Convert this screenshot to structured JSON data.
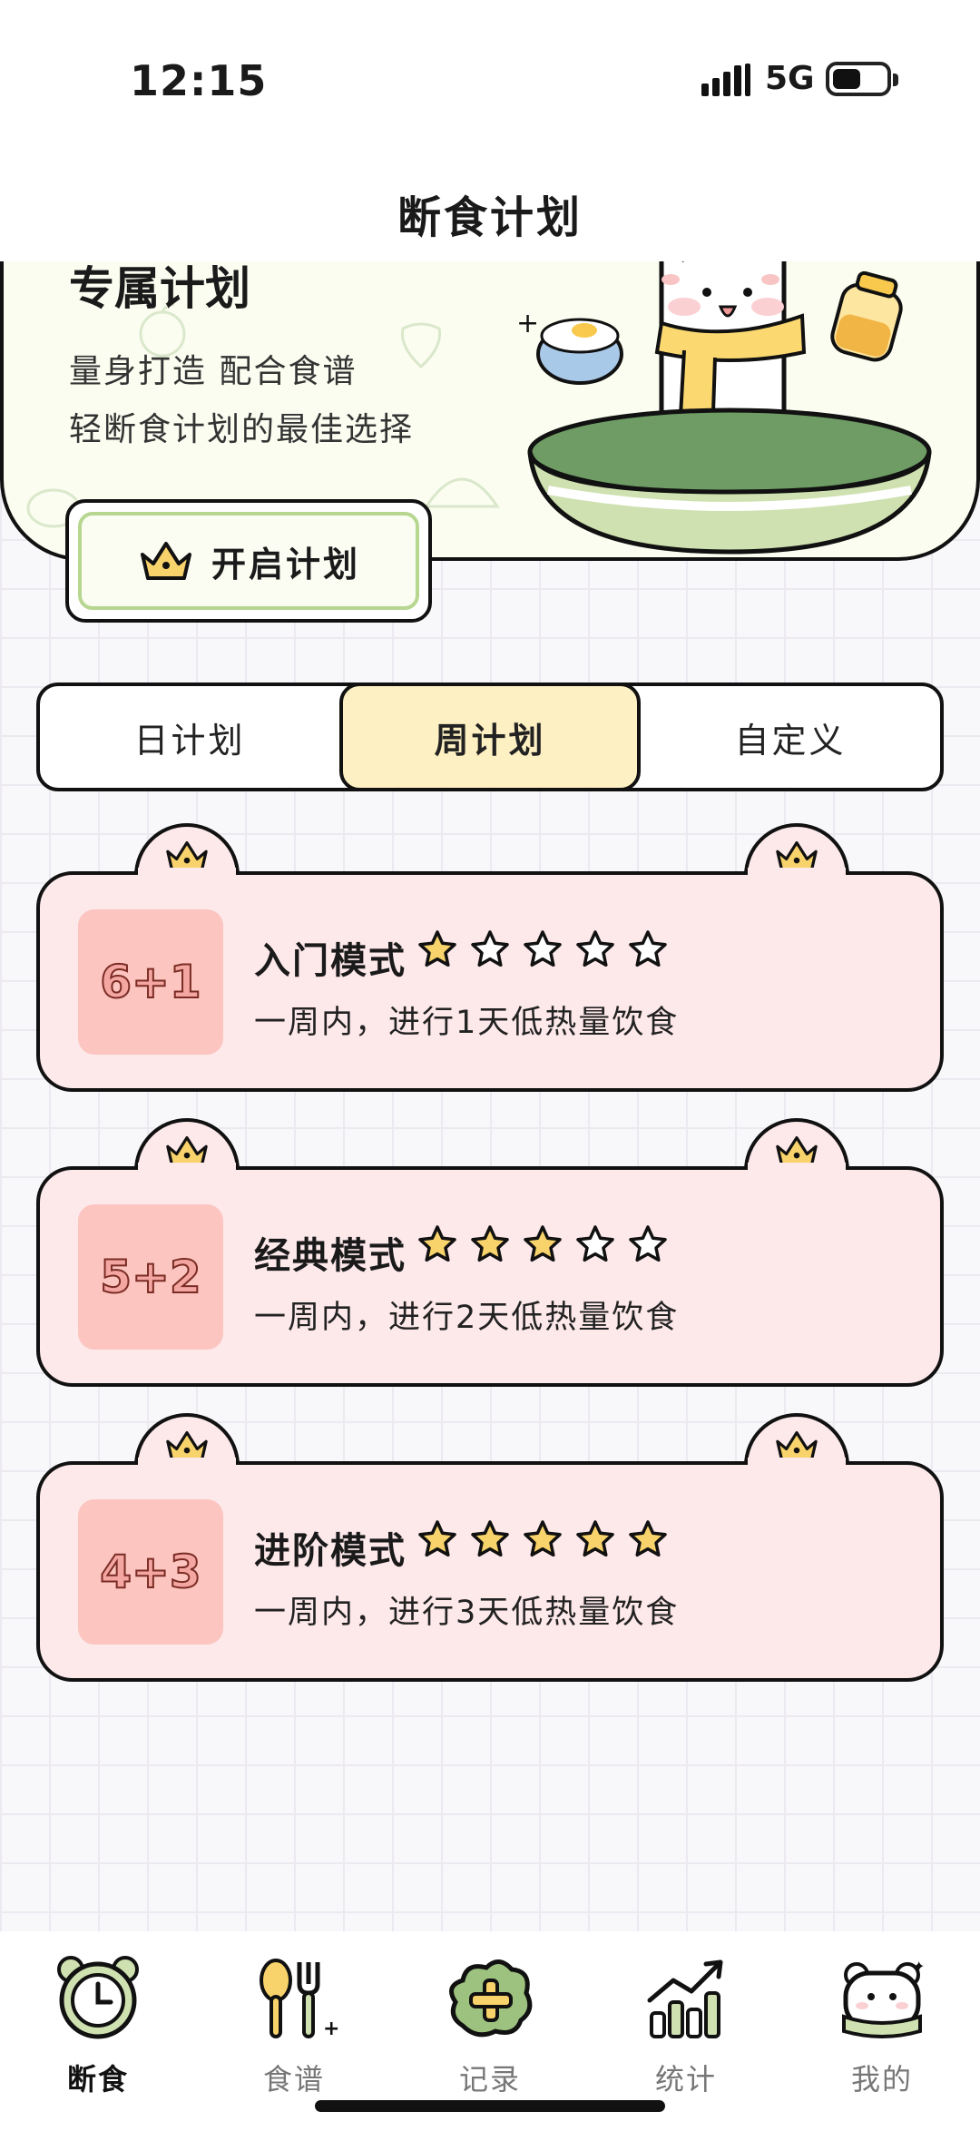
{
  "status_bar": {
    "time": "12:15",
    "network": "5G"
  },
  "header": {
    "title": "断食计划"
  },
  "hero": {
    "title": "专属计划",
    "line1": "量身打造 配合食谱",
    "line2": "轻断食计划的最佳选择",
    "start_button": "开启计划"
  },
  "segments": [
    {
      "label": "日计划",
      "active": false
    },
    {
      "label": "周计划",
      "active": true
    },
    {
      "label": "自定义",
      "active": false
    }
  ],
  "plans": [
    {
      "badge": "6+1",
      "name": "入门模式",
      "rating": 1,
      "max_rating": 5,
      "desc": "一周内，进行1天低热量饮食"
    },
    {
      "badge": "5+2",
      "name": "经典模式",
      "rating": 3,
      "max_rating": 5,
      "desc": "一周内，进行2天低热量饮食"
    },
    {
      "badge": "4+3",
      "name": "进阶模式",
      "rating": 5,
      "max_rating": 5,
      "desc": "一周内，进行3天低热量饮食"
    }
  ],
  "tabs": [
    {
      "label": "断食",
      "icon": "alarm-clock-icon",
      "active": true
    },
    {
      "label": "食谱",
      "icon": "spoon-fork-icon",
      "active": false
    },
    {
      "label": "记录",
      "icon": "plus-cloud-icon",
      "active": false
    },
    {
      "label": "统计",
      "icon": "bar-chart-icon",
      "active": false
    },
    {
      "label": "我的",
      "icon": "bear-profile-icon",
      "active": false
    }
  ],
  "colors": {
    "star_filled": "#f8d26a",
    "card_bg": "#fde8ea",
    "badge_bg": "#fcc5c0",
    "segment_active": "#fdf0c2",
    "hero_bg": "#fbfdf0",
    "accent_green": "#b7d690"
  }
}
